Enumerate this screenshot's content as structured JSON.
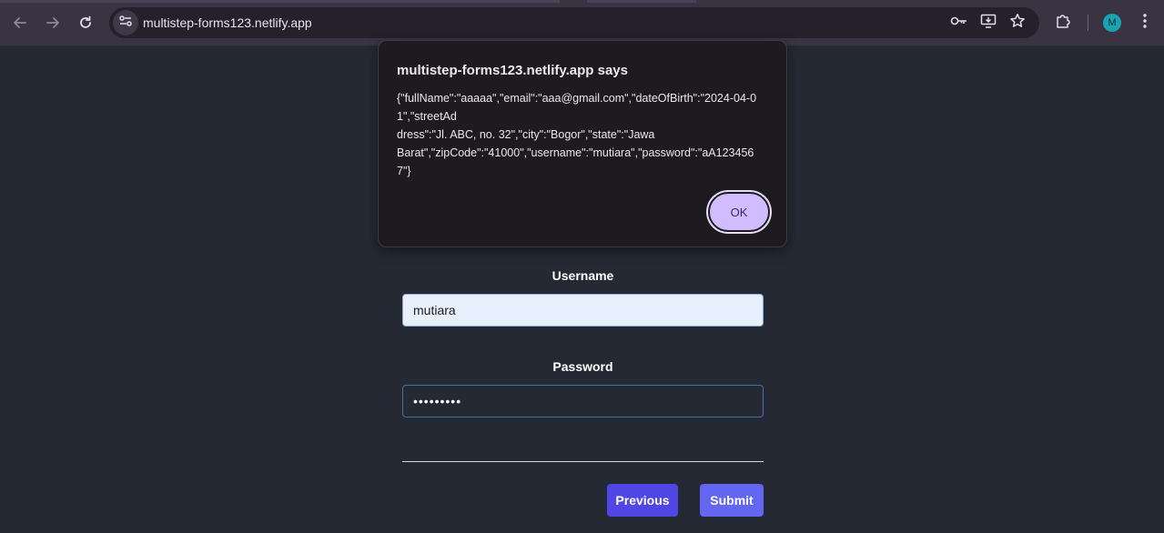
{
  "browser": {
    "url": "multistep-forms123.netlify.app",
    "profile_initial": "M",
    "icons": [
      "back-arrow-icon",
      "forward-arrow-icon",
      "reload-icon",
      "site-info-icon",
      "key-icon",
      "install-app-icon",
      "star-icon",
      "extensions-icon",
      "more-vert-icon"
    ]
  },
  "dialog": {
    "title": "multistep-forms123.netlify.app says",
    "message_lines": [
      "{\"fullName\":\"aaaaa\",\"email\":\"aaa@gmail.com\",\"dateOfBirth\":\"2024-04-0",
      "1\",\"streetAd",
      "dress\":\"Jl. ABC, no. 32\",\"city\":\"Bogor\",\"state\":\"Jawa",
      "Barat\",\"zipCode\":\"41000\",\"username\":\"mutiara\",\"password\":\"aA123456",
      "7\"}"
    ],
    "ok_label": "OK"
  },
  "form": {
    "username_label": "Username",
    "username_value": "mutiara",
    "password_label": "Password",
    "password_value": "•••••••••",
    "previous_label": "Previous",
    "submit_label": "Submit"
  },
  "colors": {
    "page_bg": "#242933",
    "toolbar_bg": "#3a3344",
    "previous_button": "#4f46e5",
    "submit_button": "#6366f1",
    "dialog_bg": "#1d1b20",
    "ok_button": "#d0bcff"
  }
}
